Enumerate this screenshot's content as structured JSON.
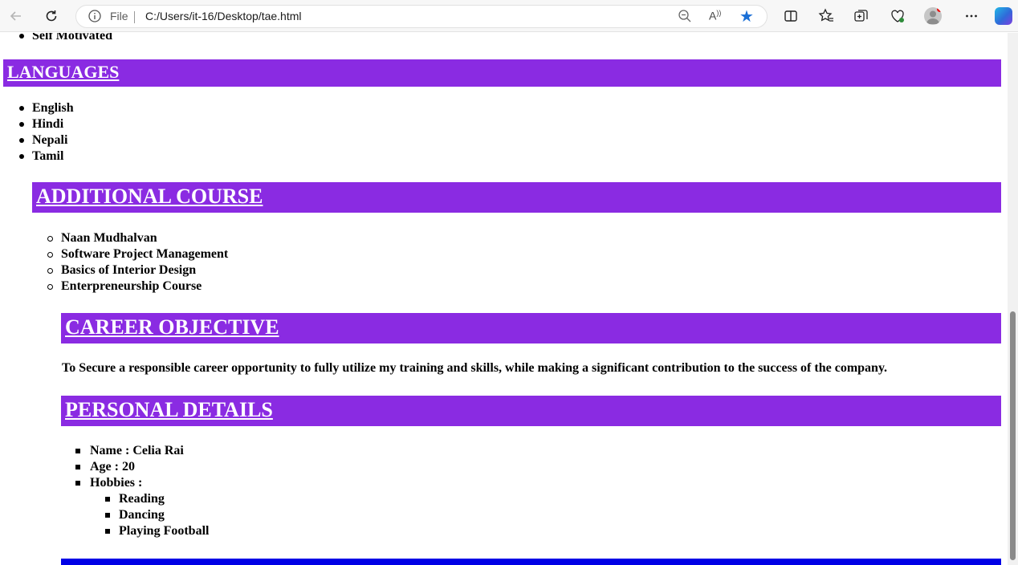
{
  "browser": {
    "file_label": "File",
    "url": "C:/Users/it-16/Desktop/tae.html",
    "read_aloud_label": "A)",
    "toolbar_icons": [
      "back-icon",
      "refresh-icon",
      "info-icon",
      "zoom-icon",
      "read-aloud-icon",
      "favorite-star-icon",
      "split-screen-icon",
      "favorites-icon",
      "collections-icon",
      "browser-essentials-icon",
      "profile-icon",
      "more-icon",
      "copilot-icon"
    ],
    "accent_color": "#1a6fd6"
  },
  "page": {
    "skills": {
      "last_item": "Self Motivated"
    },
    "languages": {
      "heading": "LANGUAGES",
      "items": [
        "English",
        "Hindi",
        "Nepali",
        "Tamil"
      ]
    },
    "additional_course": {
      "heading": "ADDITIONAL COURSE",
      "items": [
        "Naan Mudhalvan",
        "Software Project Management",
        "Basics of Interior Design",
        "Enterpreneurship Course"
      ]
    },
    "career_objective": {
      "heading": "CAREER OBJECTIVE",
      "text": "To Secure a responsible career opportunity to fully utilize my training and skills, while making a significant contribution to the success of the company."
    },
    "personal_details": {
      "heading": "PERSONAL DETAILS",
      "name": "Name : Celia Rai",
      "age": "Age : 20",
      "hobbies_label": "Hobbies :",
      "hobbies": [
        "Reading",
        "Dancing",
        "Playing Football"
      ]
    },
    "colors": {
      "section_bar": "#8a2be2",
      "footer_bar": "#0000e6"
    }
  }
}
